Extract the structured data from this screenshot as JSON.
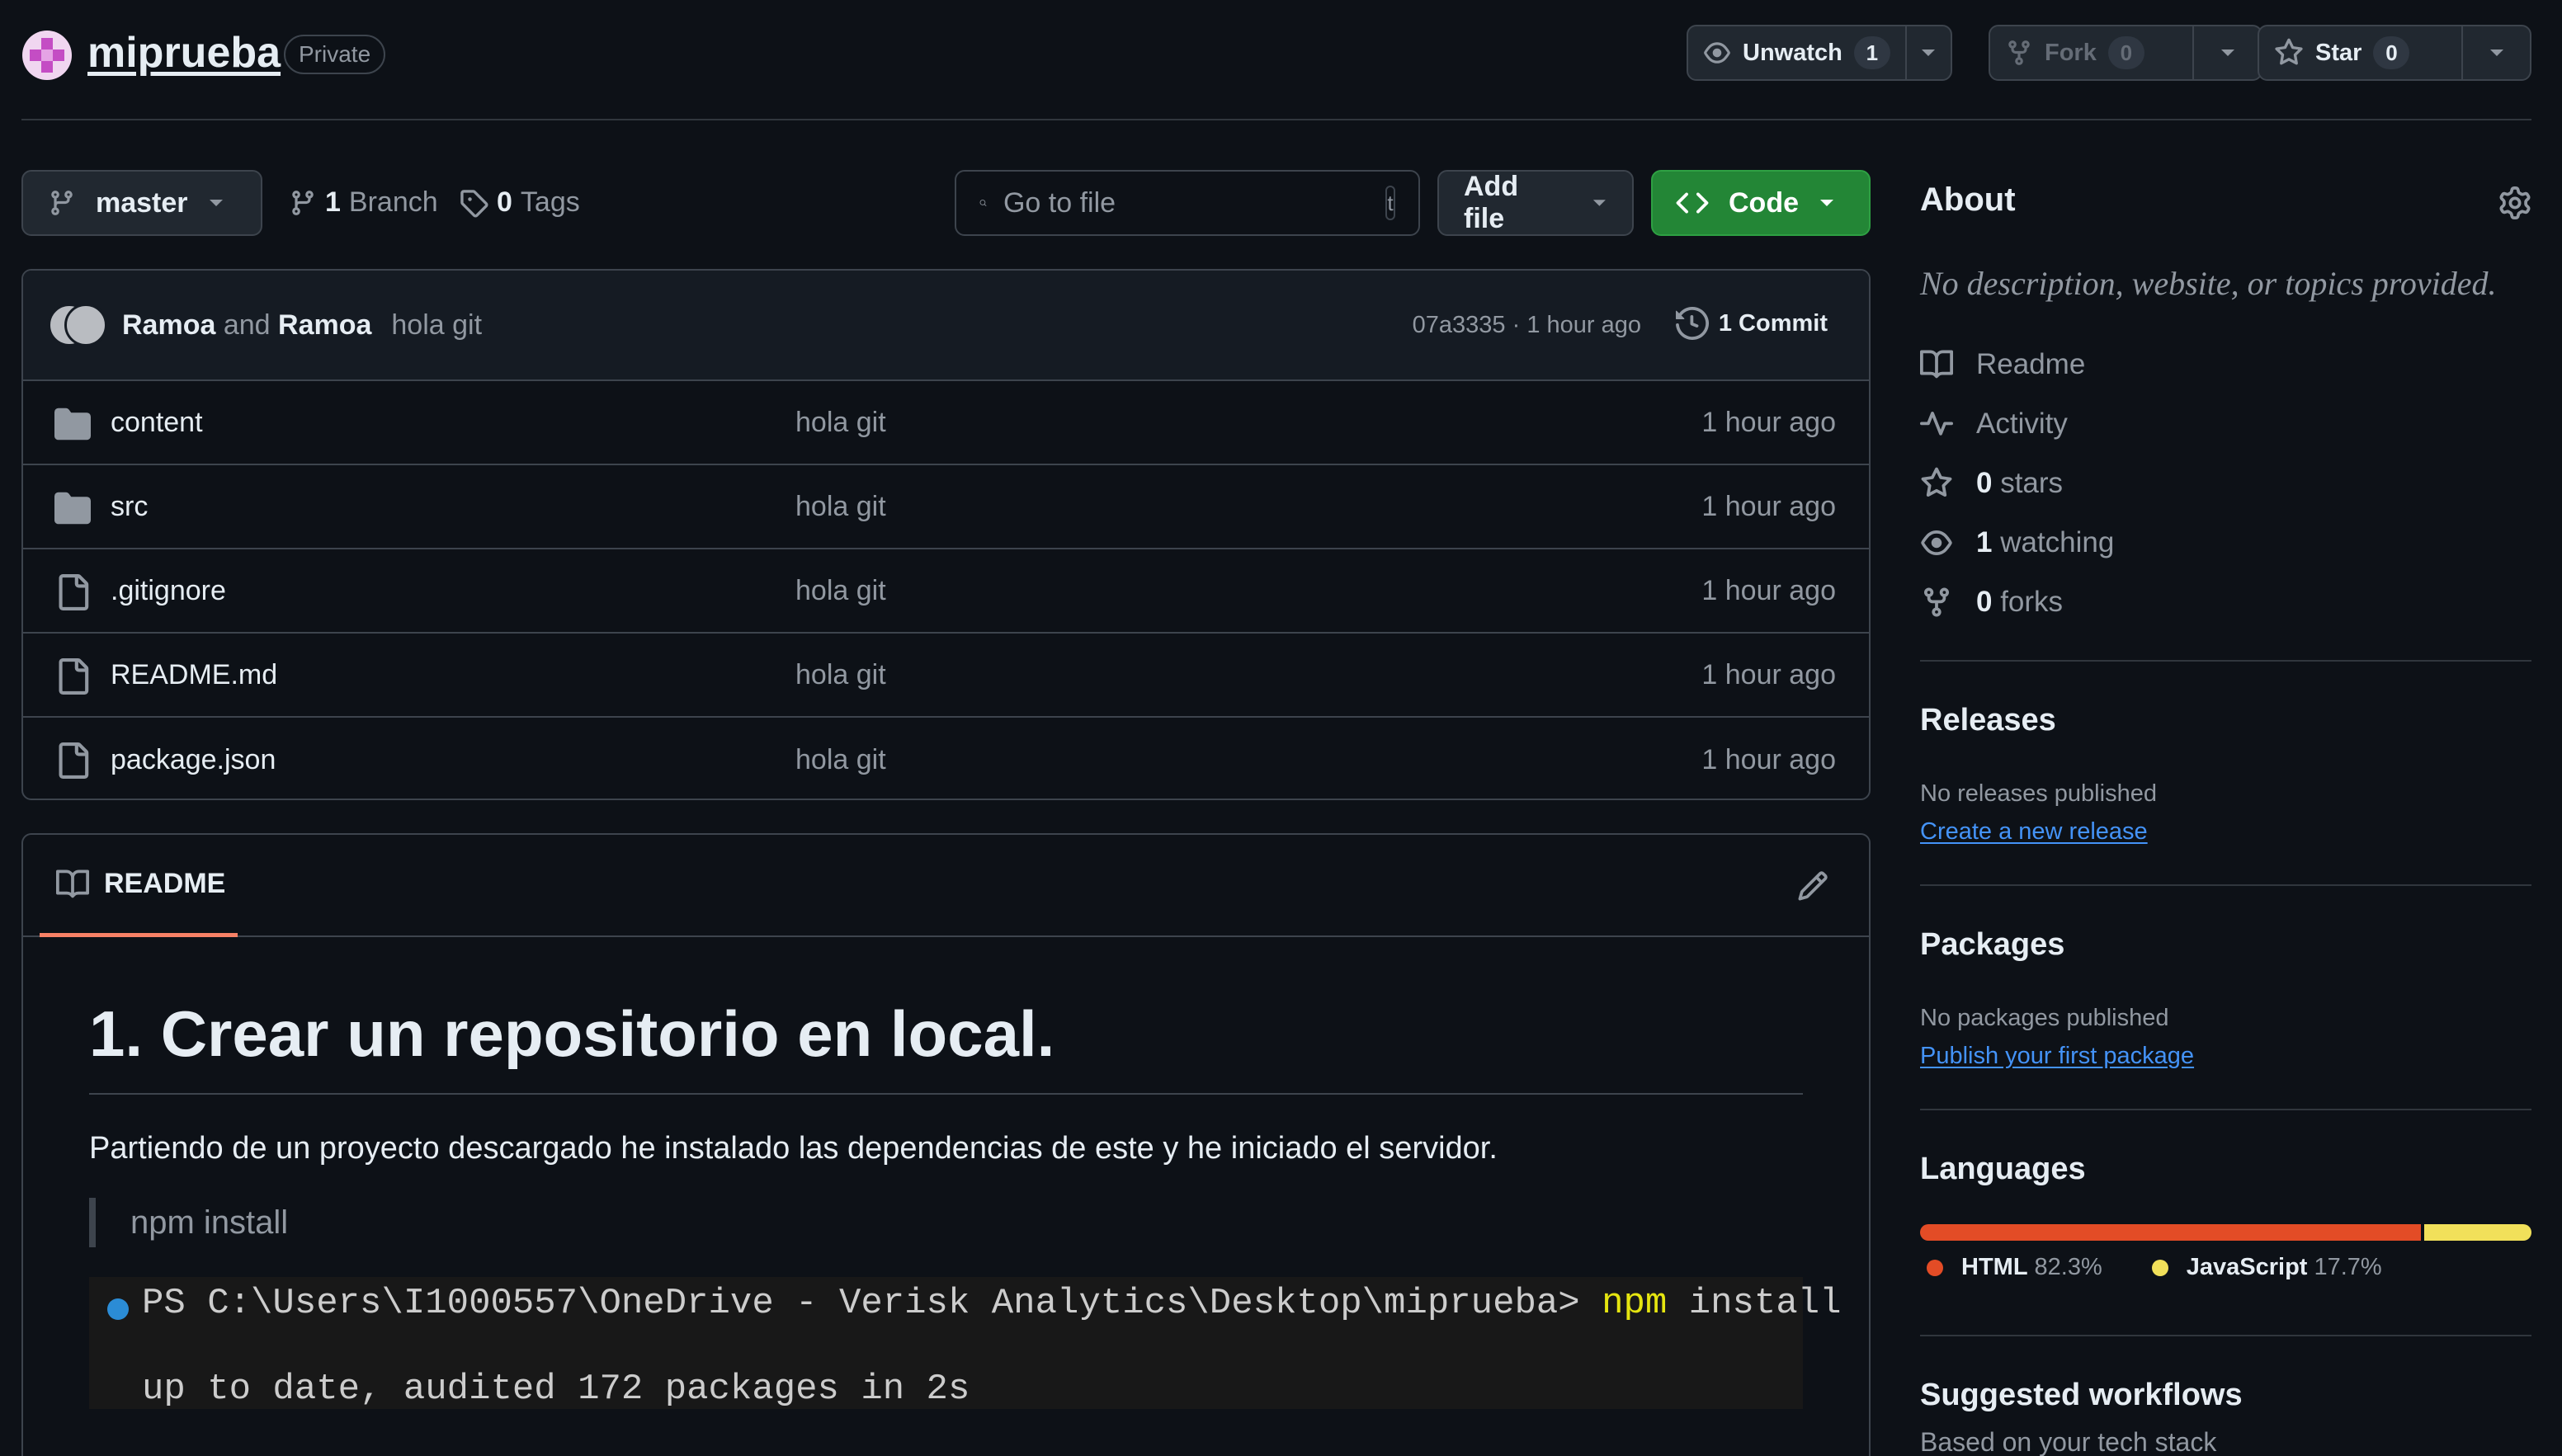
{
  "repo": {
    "name": "miprueba",
    "visibility": "Private",
    "actions": {
      "unwatch": {
        "label": "Unwatch",
        "count": "1"
      },
      "fork": {
        "label": "Fork",
        "count": "0"
      },
      "star": {
        "label": "Star",
        "count": "0"
      }
    }
  },
  "toolbar": {
    "branch": "master",
    "branches_count": "1",
    "branches_label": "Branch",
    "tags_count": "0",
    "tags_label": "Tags",
    "search_placeholder": "Go to file",
    "search_shortcut": "t",
    "add_file_label": "Add file",
    "code_label": "Code"
  },
  "last_commit": {
    "author1": "Ramoa",
    "joiner": "and",
    "author2": "Ramoa",
    "message": "hola git",
    "meta": "07a3335 · 1 hour ago",
    "commits_label": "1 Commit"
  },
  "files": [
    {
      "type": "folder",
      "name": "content",
      "message": "hola git",
      "age": "1 hour ago"
    },
    {
      "type": "folder",
      "name": "src",
      "message": "hola git",
      "age": "1 hour ago"
    },
    {
      "type": "file",
      "name": ".gitignore",
      "message": "hola git",
      "age": "1 hour ago"
    },
    {
      "type": "file",
      "name": "README.md",
      "message": "hola git",
      "age": "1 hour ago"
    },
    {
      "type": "file",
      "name": "package.json",
      "message": "hola git",
      "age": "1 hour ago"
    }
  ],
  "readme": {
    "tab_label": "README",
    "heading": "1. Crear un repositorio en local.",
    "paragraph": "Partiendo de un proyecto descargado he instalado las dependencias de este y he iniciado el servidor.",
    "quote": "npm install",
    "terminal": {
      "prompt": "PS C:\\Users\\I1000557\\OneDrive - Verisk Analytics\\Desktop\\miprueba>",
      "cmd": "npm",
      "arg": "install",
      "output": "up to date, audited 172 packages in 2s"
    }
  },
  "sidebar": {
    "about_title": "About",
    "about_desc": "No description, website, or topics provided.",
    "meta": {
      "readme": "Readme",
      "activity": "Activity",
      "stars_count": "0",
      "stars_label": "stars",
      "watching_count": "1",
      "watching_label": "watching",
      "forks_count": "0",
      "forks_label": "forks"
    },
    "releases_title": "Releases",
    "releases_sub": "No releases published",
    "releases_link": "Create a new release",
    "packages_title": "Packages",
    "packages_sub": "No packages published",
    "packages_link": "Publish your first package",
    "languages_title": "Languages",
    "languages": [
      {
        "name": "HTML",
        "percent": "82.3%",
        "value": 82.3,
        "color": "#e34c26"
      },
      {
        "name": "JavaScript",
        "percent": "17.7%",
        "value": 17.7,
        "color": "#f1e05a"
      }
    ],
    "workflows_title": "Suggested workflows",
    "workflows_sub": "Based on your tech stack"
  },
  "colors": {
    "accent_green": "#238636",
    "link_blue": "#4493f8",
    "tab_underline": "#f78166"
  }
}
